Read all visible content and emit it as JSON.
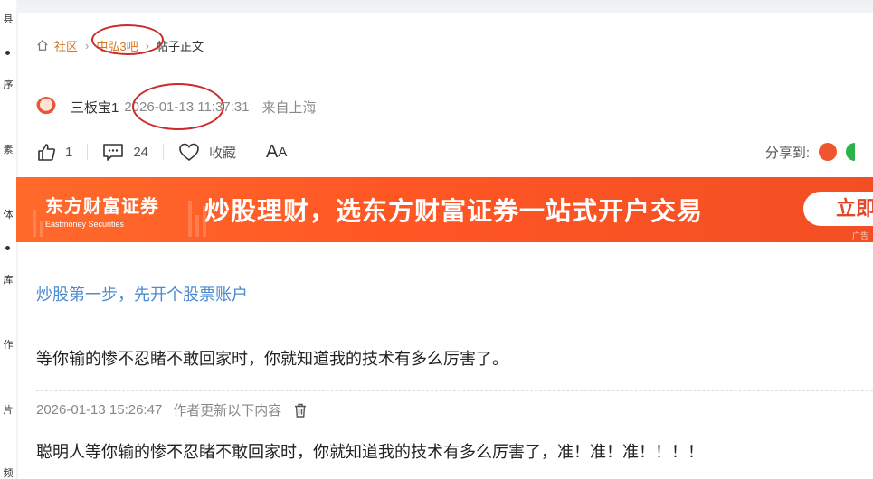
{
  "sidebar": {
    "items": [
      {
        "label": "县"
      },
      {
        "label": "序"
      },
      {
        "label": "素"
      },
      {
        "label": "体"
      },
      {
        "label": "库"
      },
      {
        "label": "作"
      },
      {
        "label": "片"
      },
      {
        "label": "频"
      }
    ]
  },
  "breadcrumb": {
    "home_icon": "home-icon",
    "items": [
      {
        "label": "社区"
      },
      {
        "label": "中弘3吧"
      },
      {
        "label": "帖子正文"
      }
    ],
    "separator": "›"
  },
  "post": {
    "author": "三板宝1",
    "time": "2026-01-13 11:37:31",
    "location": "来自上海"
  },
  "actions": {
    "like_count": "1",
    "comment_count": "24",
    "collect_label": "收藏",
    "font_big": "A",
    "font_small": "A",
    "share_label": "分享到:"
  },
  "banner": {
    "logo_cn": "东方财富证券",
    "logo_en": "Eastmoney Securities",
    "slogan": "炒股理财，选东方财富证券一站式开户交易",
    "button": "立即",
    "ad_tag": "广告"
  },
  "promo_link": "炒股第一步，先开个股票账户",
  "content": {
    "body": "等你输的惨不忍睹不敢回家时，你就知道我的技术有多么厉害了。",
    "update_time": "2026-01-13 15:26:47",
    "update_note": "作者更新以下内容",
    "update_body": "聪明人等你输的惨不忍睹不敢回家时，你就知道我的技术有多么厉害了，准！准！准！！！！"
  },
  "colors": {
    "accent_orange": "#d4741f",
    "banner_orange": "#ff5a26",
    "link_blue": "#4a8bd1",
    "annotation_red": "#cc2a2a"
  }
}
